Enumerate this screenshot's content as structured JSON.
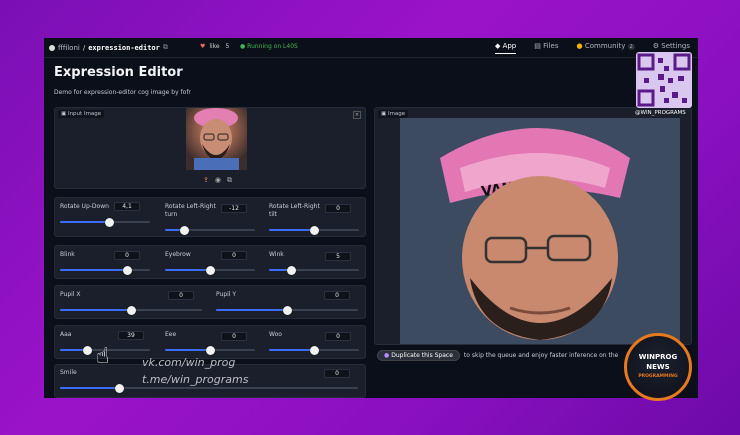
{
  "topbar": {
    "owner": "fffiloni",
    "separator": "/",
    "repo": "expression-editor",
    "like_label": "like",
    "like_count": "5",
    "status": "Running on L40S",
    "tabs": [
      {
        "label": "App"
      },
      {
        "label": "Files"
      },
      {
        "label": "Community"
      },
      {
        "label": "Settings"
      }
    ],
    "community_count": "2"
  },
  "page": {
    "title": "Expression Editor",
    "subtitle": "Demo for expression-editor cog image by fofr"
  },
  "input_panel": {
    "label": "Input Image",
    "close": "×"
  },
  "output_panel": {
    "label": "Image"
  },
  "sliders": {
    "rotate_up_down": {
      "label": "Rotate Up-Down",
      "value": "4,1",
      "fraction": 0.55
    },
    "rotate_left_right_turn": {
      "label": "Rotate Left-Right turn",
      "value": "-12",
      "fraction": 0.22
    },
    "rotate_left_right_tilt": {
      "label": "Rotate Left-Right tilt",
      "value": "0",
      "fraction": 0.5
    },
    "blink": {
      "label": "Blink",
      "value": "0",
      "fraction": 0.75
    },
    "eyebrow": {
      "label": "Eyebrow",
      "value": "0",
      "fraction": 0.5
    },
    "wink": {
      "label": "Wink",
      "value": "5",
      "fraction": 0.25
    },
    "pupil_x": {
      "label": "Pupil X",
      "value": "0",
      "fraction": 0.5
    },
    "pupil_y": {
      "label": "Pupil Y",
      "value": "0",
      "fraction": 0.5
    },
    "aaa": {
      "label": "Aaa",
      "value": "39",
      "fraction": 0.3
    },
    "eee": {
      "label": "Eee",
      "value": "0",
      "fraction": 0.5
    },
    "woo": {
      "label": "Woo",
      "value": "0",
      "fraction": 0.5
    },
    "smile": {
      "label": "Smile",
      "value": "0",
      "fraction": 0.2
    }
  },
  "duplicate": {
    "button": "Duplicate this Space",
    "text": "to skip the queue and enjoy faster inference on the"
  },
  "watermark": {
    "vk": "vk.com/win_prog",
    "tg": "t.me/win_programs",
    "qr_caption": "@WIN_PROGRAMS",
    "logo_top": "WINPROG",
    "logo_mid": "NEWS",
    "logo_bottom": "PROGRAMMING"
  },
  "colors": {
    "accent": "#3b6cf6",
    "running": "#3fb950",
    "bg": "#0b0f19"
  }
}
